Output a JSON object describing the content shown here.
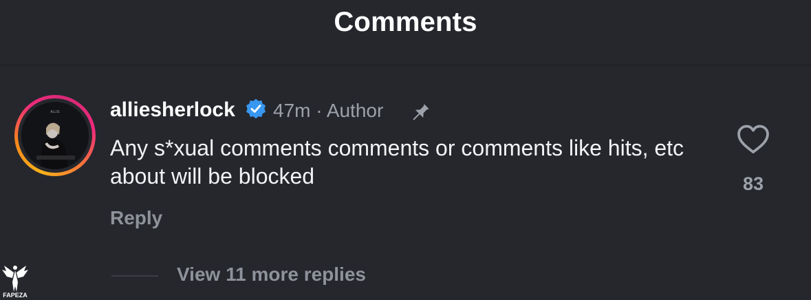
{
  "header": {
    "title": "Comments"
  },
  "comment": {
    "username": "alliesherlock",
    "verified": true,
    "time": "47m",
    "separator": "·",
    "role": "Author",
    "pinned": true,
    "text": "Any s*xual comments comments or comments like hits, etc about will be blocked",
    "reply_label": "Reply",
    "likes": "83",
    "avatar_text": "ALLIE"
  },
  "replies": {
    "view_more_label": "View 11 more replies"
  },
  "watermark": {
    "text": "FAPEZA"
  },
  "colors": {
    "background": "#25272d",
    "verified": "#3897f0",
    "muted": "#9da1a9"
  },
  "icons": {
    "verified": "verified-badge-icon",
    "pin": "pin-icon",
    "like": "heart-icon"
  }
}
